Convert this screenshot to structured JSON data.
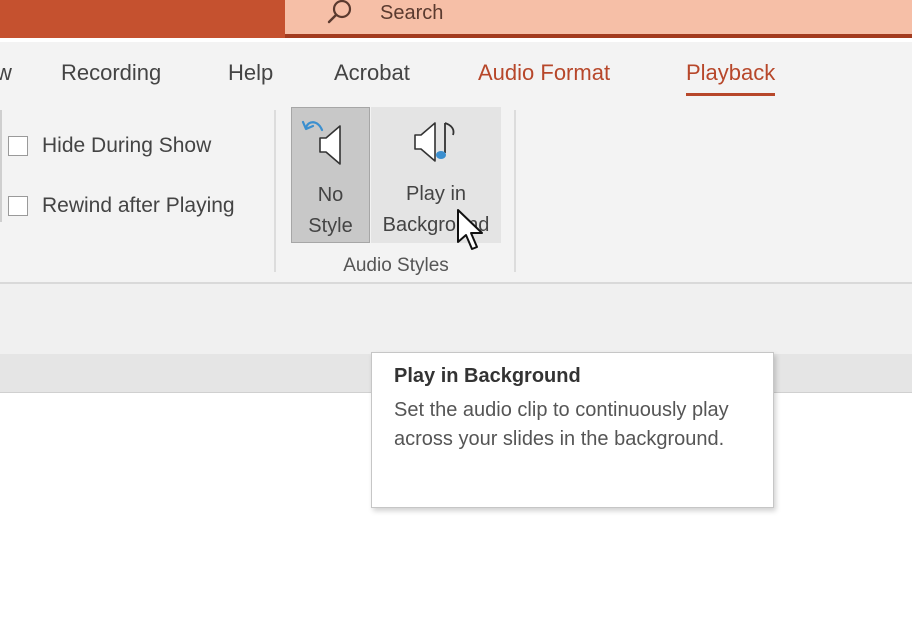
{
  "titlebar": {
    "search_placeholder": "Search"
  },
  "tabs": [
    {
      "label": "w"
    },
    {
      "label": "Recording"
    },
    {
      "label": "Help"
    },
    {
      "label": "Acrobat"
    },
    {
      "label": "Audio Format"
    },
    {
      "label": "Playback"
    }
  ],
  "active_tab": "Playback",
  "ribbon": {
    "options": {
      "hide_during_show": "Hide During Show",
      "rewind_after_playing": "Rewind after Playing"
    },
    "audio_styles": {
      "group_label": "Audio Styles",
      "no_style_line1": "No",
      "no_style_line2": "Style",
      "play_bg_line1": "Play in",
      "play_bg_line2": "Background"
    }
  },
  "tooltip": {
    "title": "Play in Background",
    "body": "Set the audio clip to continuously play across your slides in the background."
  },
  "colors": {
    "accent": "#b7472a",
    "ribbon_bg": "#f3f3f3",
    "search_bg": "#f6bfa7"
  },
  "icons": {
    "search": "search-icon",
    "no_style": "speaker-undo-icon",
    "play_bg": "speaker-music-icon",
    "cursor": "mouse-pointer-icon"
  }
}
